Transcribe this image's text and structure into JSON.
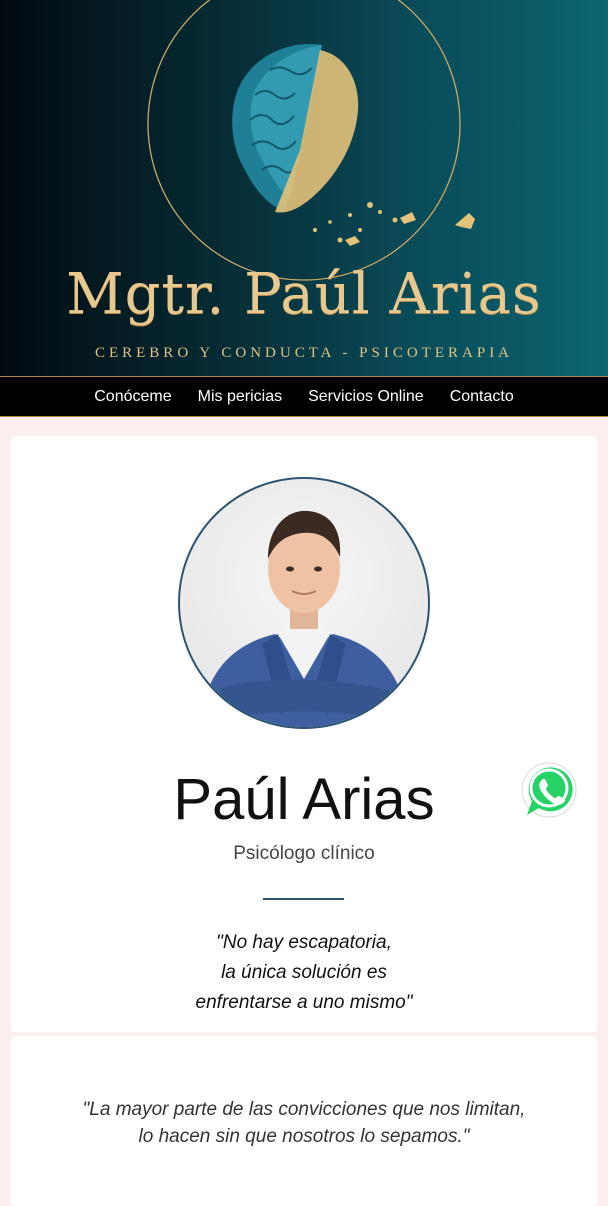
{
  "header": {
    "title": "Mgtr. Paúl Arias",
    "subtitle": "CEREBRO Y CONDUCTA - PSICOTERAPIA",
    "logo_icon": "brain-logo",
    "colors": {
      "gold": "#e7c98f",
      "teal": "#0c6470"
    }
  },
  "nav": {
    "items": [
      {
        "label": "Conóceme"
      },
      {
        "label": "Mis pericias"
      },
      {
        "label": "Servicios Online"
      },
      {
        "label": "Contacto"
      }
    ]
  },
  "profile": {
    "avatar_icon": "profile-photo",
    "name": "Paúl Arias",
    "role": "Psicólogo clínico",
    "quote_lines": [
      "\"No hay escapatoria,",
      "la única solución es",
      "enfrentarse a uno mismo\""
    ]
  },
  "quote_card": {
    "lines": [
      "\"La mayor parte de las convicciones que nos limitan,",
      "lo hacen sin que nosotros lo sepamos.\""
    ]
  },
  "whatsapp": {
    "icon": "whatsapp-icon",
    "color": "#25d366"
  }
}
